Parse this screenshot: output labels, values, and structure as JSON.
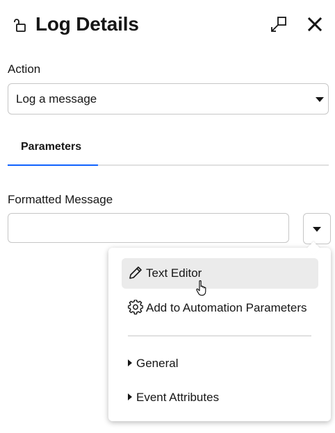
{
  "header": {
    "title": "Log Details",
    "icons": {
      "lock": "unlock-icon",
      "popout": "popout-icon",
      "close": "close-icon"
    }
  },
  "action": {
    "label": "Action",
    "selected": "Log a message"
  },
  "tabs": [
    {
      "label": "Parameters",
      "active": true
    }
  ],
  "formatted_message": {
    "label": "Formatted Message",
    "value": "",
    "placeholder": ""
  },
  "menu": {
    "items": [
      {
        "label": "Text Editor",
        "icon": "pencil-icon",
        "hovered": true
      },
      {
        "label": "Add to Automation Parameters",
        "icon": "gear-icon",
        "hovered": false
      }
    ],
    "sections": [
      {
        "label": "General",
        "expanded": false
      },
      {
        "label": "Event Attributes",
        "expanded": false
      }
    ]
  },
  "colors": {
    "accent": "#0f62fe",
    "text": "#161616",
    "border": "#c6c6c6",
    "hover": "#ebebeb"
  }
}
